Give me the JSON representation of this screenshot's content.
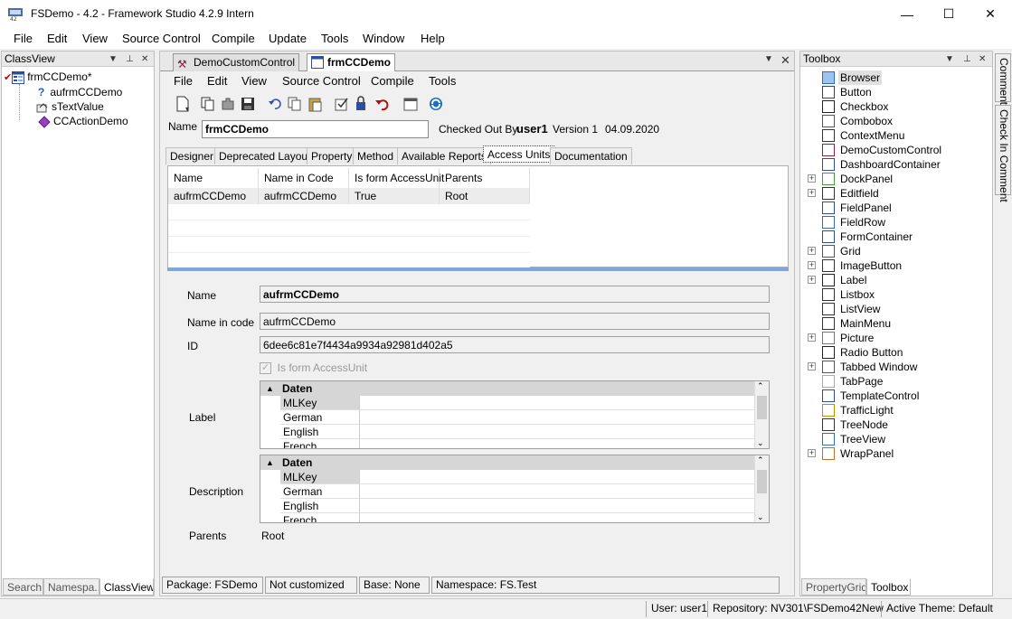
{
  "window": {
    "title": "FSDemo - 4.2 - Framework Studio 4.2.9 Intern",
    "minimize": "—",
    "maximize": "☐",
    "close": "✕"
  },
  "menu": [
    "File",
    "Edit",
    "View",
    "Source Control",
    "Compile",
    "Update",
    "Tools",
    "Window",
    "Help"
  ],
  "classview": {
    "header": "ClassView",
    "items": [
      {
        "label": "frmCCDemo*",
        "icon": "form-icon"
      },
      {
        "label": "aufrmCCDemo",
        "icon": "question-icon"
      },
      {
        "label": "sTextValue",
        "icon": "property-icon"
      },
      {
        "label": "CCActionDemo",
        "icon": "action-icon"
      }
    ],
    "tabs": [
      "Search",
      "Namespa...",
      "ClassView"
    ]
  },
  "document": {
    "tabs": [
      {
        "label": "DemoCustomControl",
        "active": false
      },
      {
        "label": "frmCCDemo",
        "active": true
      }
    ],
    "menu": [
      "File",
      "Edit",
      "View",
      "Source Control",
      "Compile",
      "Tools"
    ],
    "name_label": "Name",
    "name_value": "frmCCDemo",
    "checked_out_label": "Checked Out By",
    "checked_out_user": "user1",
    "version": "Version 1",
    "date": "04.09.2020",
    "subtabs": [
      "Designer",
      "Deprecated Layout",
      "Property",
      "Method",
      "Available Reports",
      "Access Units",
      "Documentation"
    ],
    "active_subtab": "Access Units",
    "grid": {
      "columns": [
        "Name",
        "Name in Code",
        "Is form AccessUnit",
        "Parents"
      ],
      "rows": [
        [
          "aufrmCCDemo",
          "aufrmCCDemo",
          "True",
          "Root"
        ]
      ]
    },
    "detail": {
      "name_label": "Name",
      "name_value": "aufrmCCDemo",
      "name_in_code_label": "Name in code",
      "name_in_code_value": "aufrmCCDemo",
      "id_label": "ID",
      "id_value": "6dee6c81e7f4434a9934a92981d402a5",
      "is_form_label": "Is form AccessUnit",
      "label_label": "Label",
      "description_label": "Description",
      "category": "Daten",
      "keys": [
        "MLKey",
        "German",
        "English",
        "French"
      ],
      "parents_label": "Parents",
      "parents_value": "Root"
    },
    "status": [
      "Package: FSDemo",
      "Not customized",
      "Base: None",
      "Namespace: FS.Test"
    ]
  },
  "toolbox": {
    "header": "Toolbox",
    "items": [
      {
        "label": "Browser",
        "expandable": false
      },
      {
        "label": "Button",
        "expandable": false
      },
      {
        "label": "Checkbox",
        "expandable": false
      },
      {
        "label": "Combobox",
        "expandable": false
      },
      {
        "label": "ContextMenu",
        "expandable": false
      },
      {
        "label": "DemoCustomControl",
        "expandable": false
      },
      {
        "label": "DashboardContainer",
        "expandable": false
      },
      {
        "label": "DockPanel",
        "expandable": true
      },
      {
        "label": "Editfield",
        "expandable": true
      },
      {
        "label": "FieldPanel",
        "expandable": false
      },
      {
        "label": "FieldRow",
        "expandable": false
      },
      {
        "label": "FormContainer",
        "expandable": false
      },
      {
        "label": "Grid",
        "expandable": true
      },
      {
        "label": "ImageButton",
        "expandable": true
      },
      {
        "label": "Label",
        "expandable": true
      },
      {
        "label": "Listbox",
        "expandable": false
      },
      {
        "label": "ListView",
        "expandable": false
      },
      {
        "label": "MainMenu",
        "expandable": false
      },
      {
        "label": "Picture",
        "expandable": true
      },
      {
        "label": "Radio Button",
        "expandable": false
      },
      {
        "label": "Tabbed Window",
        "expandable": true
      },
      {
        "label": "TabPage",
        "expandable": false
      },
      {
        "label": "TemplateControl",
        "expandable": false
      },
      {
        "label": "TrafficLight",
        "expandable": false
      },
      {
        "label": "TreeNode",
        "expandable": false
      },
      {
        "label": "TreeView",
        "expandable": false
      },
      {
        "label": "WrapPanel",
        "expandable": true
      }
    ],
    "tabs": [
      "PropertyGrid",
      "Toolbox"
    ]
  },
  "side_tabs": [
    "Comment",
    "Check In Comment"
  ],
  "statusbar": {
    "user": "User: user1",
    "repository": "Repository: NV301\\FSDemo42New",
    "theme": "Active Theme: Default"
  }
}
